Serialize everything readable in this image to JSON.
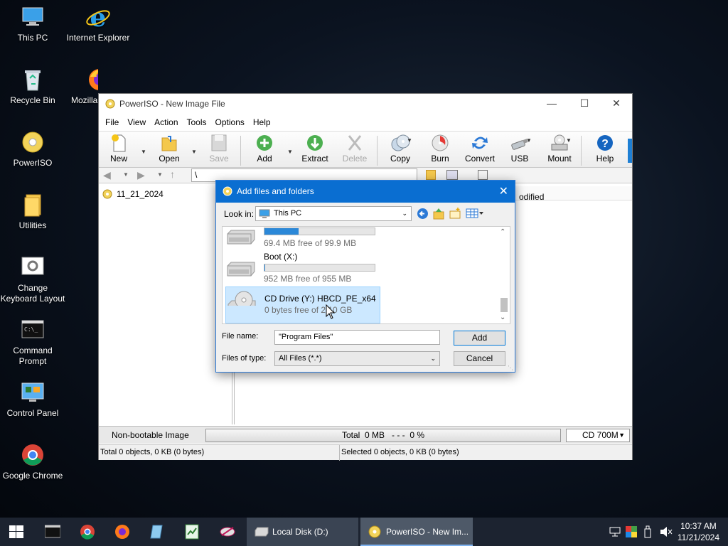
{
  "desktop": {
    "icons": [
      {
        "label": "This PC"
      },
      {
        "label": "Internet Explorer"
      },
      {
        "label": "Recycle Bin"
      },
      {
        "label": "Mozilla"
      },
      {
        "label": "PowerISO"
      },
      {
        "label": "Utilities"
      },
      {
        "label": "Change Keyboard Layout"
      },
      {
        "label": "Command Prompt"
      },
      {
        "label": "Control Panel"
      },
      {
        "label": "Google Chrome"
      }
    ]
  },
  "window": {
    "title": "PowerISO - New Image File",
    "menu": [
      "File",
      "View",
      "Action",
      "Tools",
      "Options",
      "Help"
    ],
    "toolbar": [
      "New",
      "Open",
      "Save",
      "Add",
      "Extract",
      "Delete",
      "Copy",
      "Burn",
      "Convert",
      "USB",
      "Mount",
      "Help"
    ],
    "path": "\\",
    "tree_root": "11_21_2024",
    "column_partial": "odified",
    "info": {
      "boot_status": "Non-bootable Image",
      "total": "Total  0 MB   - - -  0 %",
      "media": "CD 700M"
    },
    "status": {
      "left": "Total 0 objects, 0 KB (0 bytes)",
      "right": "Selected 0 objects, 0 KB (0 bytes)"
    }
  },
  "dialog": {
    "title": "Add files and folders",
    "look_in_label": "Look in:",
    "look_in_value": "This PC",
    "drives": [
      {
        "name": "",
        "free": "69.4 MB free of 99.9 MB",
        "used_fraction": 0.31
      },
      {
        "name": "Boot (X:)",
        "free": "952 MB free of 955 MB",
        "used_fraction": 0.003
      },
      {
        "name": "CD Drive (Y:) HBCD_PE_x64",
        "free": "0 bytes free of 2.10 GB",
        "used_fraction": 1.0
      }
    ],
    "file_name_label": "File name:",
    "file_name_value": "\"Program Files\"",
    "file_type_label": "Files of type:",
    "file_type_value": "All Files (*.*)",
    "add_button": "Add",
    "cancel_button": "Cancel"
  },
  "taskbar": {
    "tasks": [
      "Local Disk (D:)",
      "PowerISO - New Im..."
    ],
    "time": "10:37 AM",
    "date": "11/21/2024"
  },
  "colors": {
    "accent": "#0a6ed1",
    "selection": "#cce8ff",
    "taskbar": "#1c2330"
  }
}
